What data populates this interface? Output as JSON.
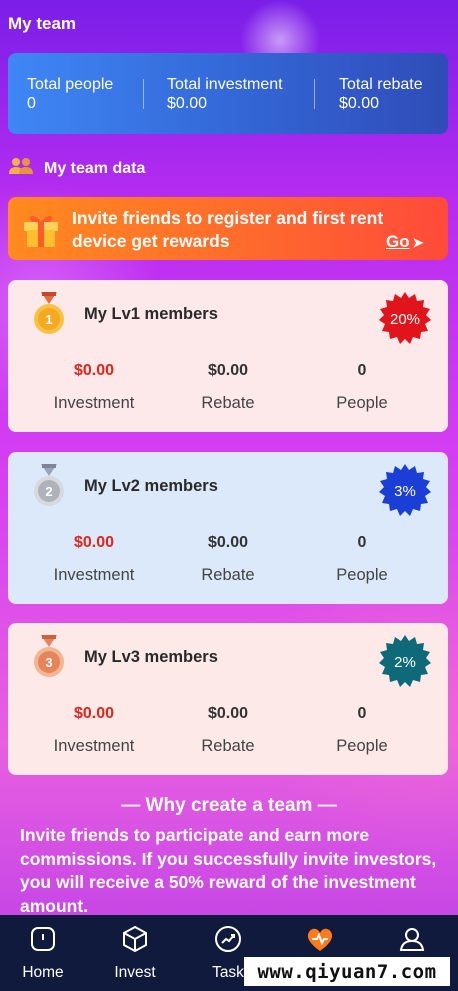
{
  "header": {
    "title": "My team"
  },
  "summary": {
    "total_people_label": "Total people",
    "total_people_value": "0",
    "total_investment_label": "Total investment",
    "total_investment_value": "$0.00",
    "total_rebate_label": "Total rebate",
    "total_rebate_value": "$0.00"
  },
  "section": {
    "title": "My team data",
    "icon": "team-icon"
  },
  "invite": {
    "text": "Invite friends to register and first rent device get rewards",
    "go_label": "Go",
    "icon": "gift-icon"
  },
  "levels": [
    {
      "title": "My Lv1 members",
      "badge": "20%",
      "badge_color": "#e0141a",
      "medal_number": "1",
      "investment": "$0.00",
      "rebate": "$0.00",
      "people": "0",
      "investment_label": "Investment",
      "rebate_label": "Rebate",
      "people_label": "People"
    },
    {
      "title": "My Lv2 members",
      "badge": "3%",
      "badge_color": "#1b3fd6",
      "medal_number": "2",
      "investment": "$0.00",
      "rebate": "$0.00",
      "people": "0",
      "investment_label": "Investment",
      "rebate_label": "Rebate",
      "people_label": "People"
    },
    {
      "title": "My Lv3 members",
      "badge": "2%",
      "badge_color": "#0e6a78",
      "medal_number": "3",
      "investment": "$0.00",
      "rebate": "$0.00",
      "people": "0",
      "investment_label": "Investment",
      "rebate_label": "Rebate",
      "people_label": "People"
    }
  ],
  "why": {
    "title": "— Why create a team —",
    "text": "Invite friends to participate and earn more commissions. If you successfully invite investors, you will receive a 50% reward of the investment amount."
  },
  "tabbar": {
    "items": [
      {
        "label": "Home",
        "icon": "home-icon"
      },
      {
        "label": "Invest",
        "icon": "cube-icon"
      },
      {
        "label": "Task",
        "icon": "trend-icon"
      },
      {
        "label": "",
        "icon": "team-heart-icon"
      },
      {
        "label": "",
        "icon": "user-icon"
      }
    ]
  },
  "watermark": {
    "text": "www.qiyuan7.com"
  }
}
